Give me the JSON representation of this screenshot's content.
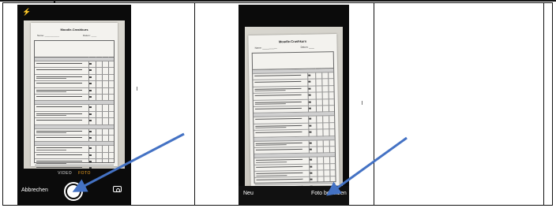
{
  "screen1": {
    "modes": {
      "video": "VIDEO",
      "foto": "FOTO"
    },
    "cancel_label": "Abbrechen",
    "flash_icon": "lightning-icon",
    "switch_icon": "camera-switch-icon",
    "document_title": "Moodle-Crashkurs",
    "name_label": "Name: ___________",
    "date_label": "Datum: ____"
  },
  "screen2": {
    "new_label": "Neu",
    "use_photo_label": "Foto benutzen",
    "document_title": "Moodle-Crashkurs",
    "name_label": "Name: ___________",
    "date_label": "Datum: ____"
  },
  "colors": {
    "arrow": "#4472c4",
    "foto_mode": "#f5a623",
    "camera_bg": "#0b0b0b"
  }
}
